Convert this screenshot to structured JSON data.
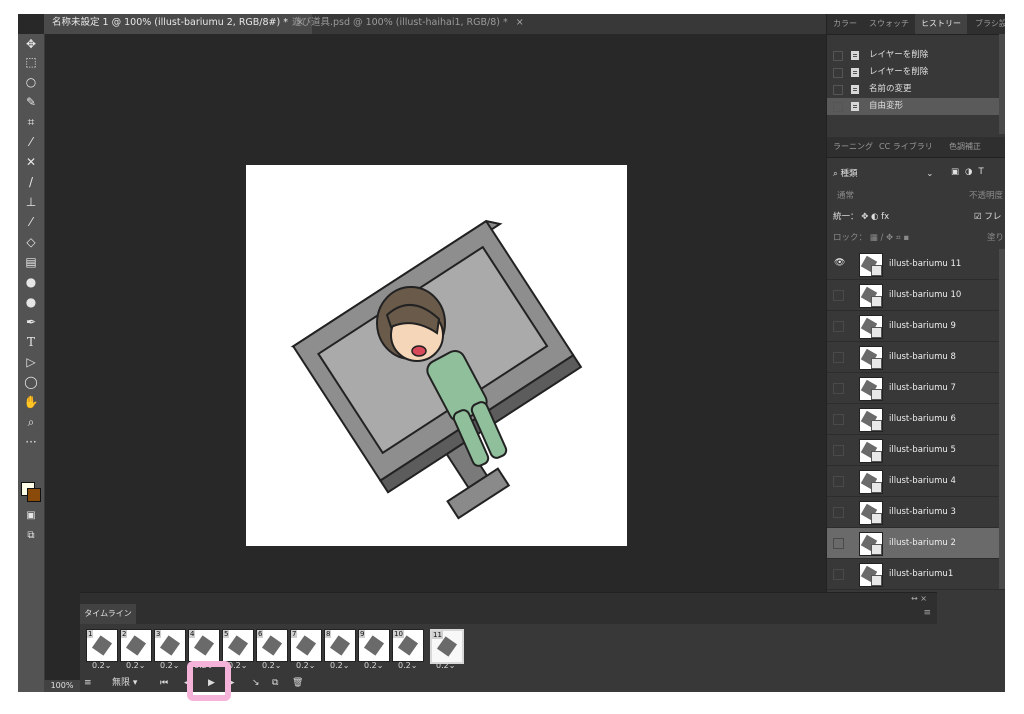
{
  "doc_tabs": [
    {
      "label": "名称未設定 1 @ 100% (illust-bariumu 2, RGB/8#) *",
      "close": "×"
    },
    {
      "label": "遊び道具.psd @ 100% (illust-haihai1, RGB/8) *",
      "close": "×"
    }
  ],
  "tools": [
    "move-icon",
    "marquee-icon",
    "lasso-icon",
    "quick-select-icon",
    "crop-icon",
    "eyedropper-icon",
    "healing-icon",
    "brush-icon",
    "stamp-icon",
    "history-brush-icon",
    "eraser-icon",
    "gradient-icon",
    "blur-icon",
    "dodge-icon",
    "pen-icon",
    "type-icon",
    "path-select-icon",
    "shape-icon",
    "hand-icon",
    "zoom-icon",
    "more-icon"
  ],
  "top_panel": {
    "tabs": [
      "カラー",
      "スウォッチ",
      "ヒストリー",
      "ブラシ設"
    ],
    "active_tab": "ヒストリー",
    "history": [
      {
        "label": "レイヤーを削除",
        "selected": false
      },
      {
        "label": "レイヤーを削除",
        "selected": false
      },
      {
        "label": "名前の変更",
        "selected": false
      },
      {
        "label": "自由変形",
        "selected": true
      }
    ]
  },
  "layers_panel": {
    "tabs": [
      "ラーニング",
      "CC ライブラリ",
      "色調補正"
    ],
    "filter_label": "種類",
    "filter_icons": [
      "image-filter-icon",
      "adjustment-filter-icon",
      "type-filter-icon"
    ],
    "blend_mode": "通常",
    "opacity_label": "不透明度",
    "unify_label": "統一：",
    "fx_label": "fx",
    "frame_label": "フレ",
    "lock_label": "ロック：",
    "fill_label": "塗り",
    "layers": [
      {
        "name": "illust-bariumu 11",
        "visible": true,
        "selected": false
      },
      {
        "name": "illust-bariumu 10",
        "visible": false,
        "selected": false
      },
      {
        "name": "illust-bariumu 9",
        "visible": false,
        "selected": false
      },
      {
        "name": "illust-bariumu 8",
        "visible": false,
        "selected": false
      },
      {
        "name": "illust-bariumu 7",
        "visible": false,
        "selected": false
      },
      {
        "name": "illust-bariumu 6",
        "visible": false,
        "selected": false
      },
      {
        "name": "illust-bariumu 5",
        "visible": false,
        "selected": false
      },
      {
        "name": "illust-bariumu 4",
        "visible": false,
        "selected": false
      },
      {
        "name": "illust-bariumu 3",
        "visible": false,
        "selected": false
      },
      {
        "name": "illust-bariumu 2",
        "visible": false,
        "selected": true
      },
      {
        "name": "illust-bariumu1",
        "visible": false,
        "selected": false
      }
    ]
  },
  "timeline": {
    "tab_label": "タイムライン",
    "frames": [
      {
        "num": "1",
        "delay": "0.2"
      },
      {
        "num": "2",
        "delay": "0.2"
      },
      {
        "num": "3",
        "delay": "0.2"
      },
      {
        "num": "4",
        "delay": "0.2"
      },
      {
        "num": "5",
        "delay": "0.2"
      },
      {
        "num": "6",
        "delay": "0.2"
      },
      {
        "num": "7",
        "delay": "0.2"
      },
      {
        "num": "8",
        "delay": "0.2"
      },
      {
        "num": "9",
        "delay": "0.2"
      },
      {
        "num": "10",
        "delay": "0.2"
      },
      {
        "num": "11",
        "delay": "0.2"
      }
    ],
    "selected_frame": 11,
    "loop": "無限",
    "controls": [
      "convert-icon",
      "first-frame-icon",
      "prev-frame-icon",
      "play-icon",
      "next-frame-icon",
      "tween-icon",
      "duplicate-frame-icon",
      "delete-frame-icon"
    ]
  },
  "status": {
    "zoom": "100%"
  },
  "colors": {
    "foreground": "#fffde7",
    "background": "#8a4a0a",
    "highlight": "#f6b3d9"
  }
}
